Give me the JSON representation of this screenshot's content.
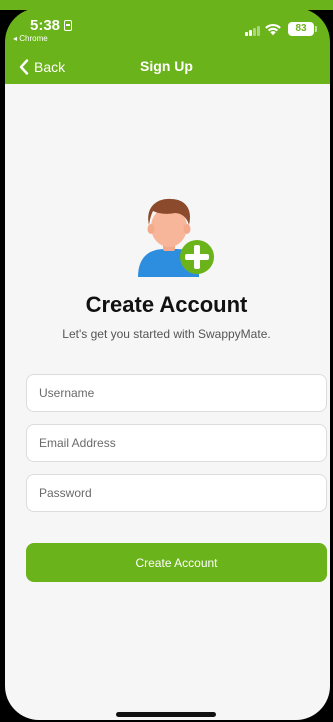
{
  "status_bar": {
    "time": "5:38",
    "back_app": "◂ Chrome",
    "battery": "83"
  },
  "nav": {
    "back_label": "Back",
    "title": "Sign Up"
  },
  "content": {
    "heading": "Create Account",
    "subheading": "Let's get you started with SwappyMate."
  },
  "form": {
    "username": {
      "value": "",
      "placeholder": "Username"
    },
    "email": {
      "value": "",
      "placeholder": "Email Address"
    },
    "password": {
      "value": "",
      "placeholder": "Password"
    },
    "submit_label": "Create Account"
  },
  "icons": {
    "avatar": "user-add-icon",
    "back": "chevron-left-icon",
    "signal": "cellular-signal-icon",
    "wifi": "wifi-icon",
    "sim": "sim-card-icon"
  },
  "colors": {
    "accent": "#6bb31a",
    "background": "#f6f6f6",
    "text": "#111111",
    "muted": "#555555"
  }
}
